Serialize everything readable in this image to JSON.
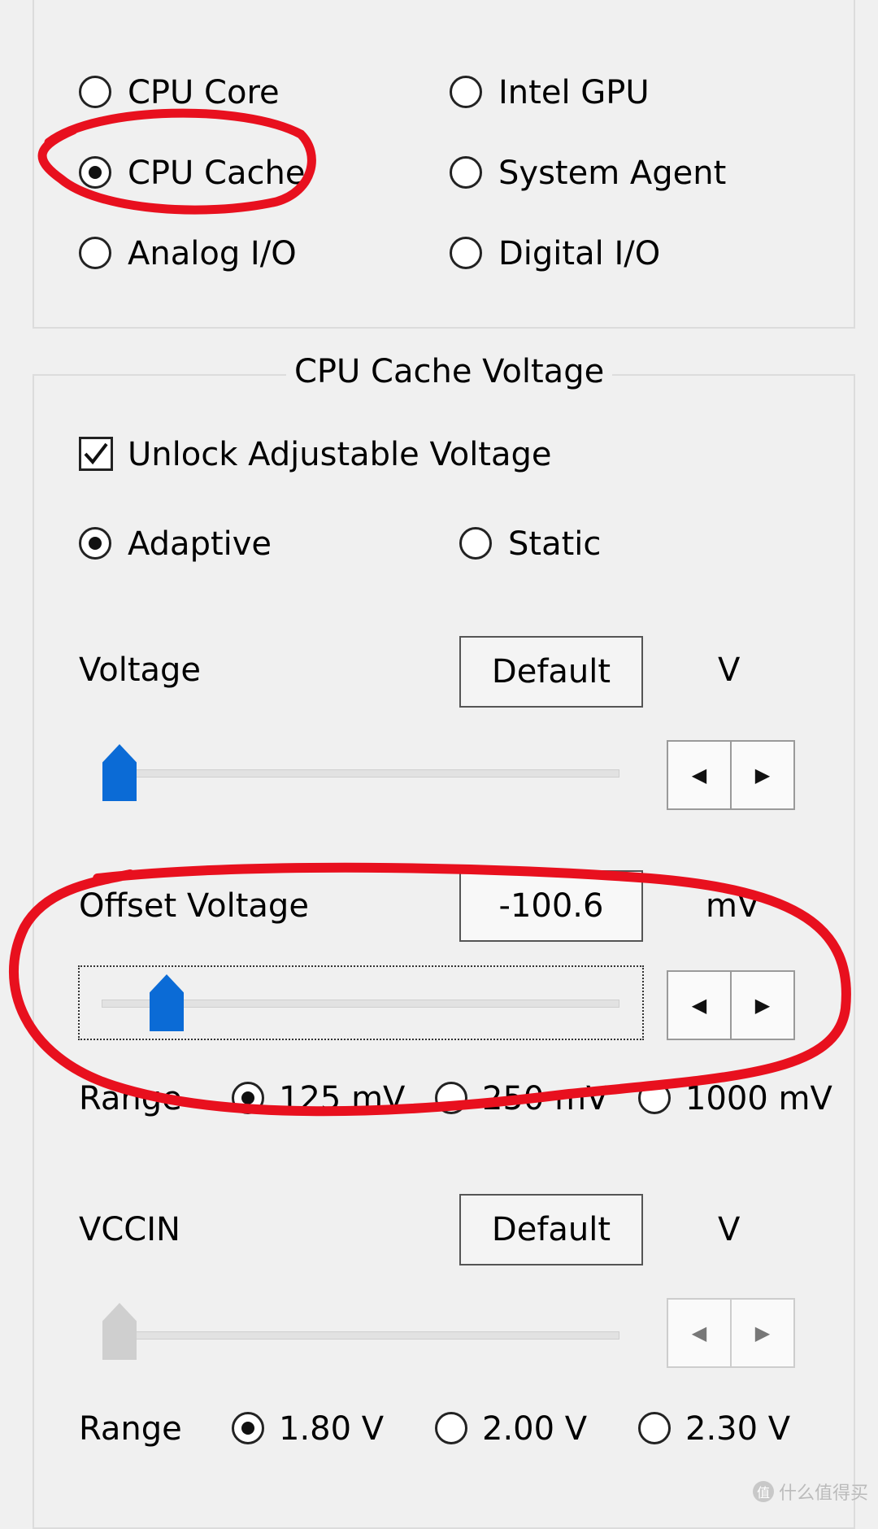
{
  "domain_select": {
    "options": [
      {
        "label": "CPU Core",
        "selected": false
      },
      {
        "label": "Intel GPU",
        "selected": false
      },
      {
        "label": "CPU Cache",
        "selected": true
      },
      {
        "label": "System Agent",
        "selected": false
      },
      {
        "label": "Analog I/O",
        "selected": false
      },
      {
        "label": "Digital I/O",
        "selected": false
      }
    ]
  },
  "group": {
    "title": "CPU Cache Voltage",
    "unlock_label": "Unlock Adjustable Voltage",
    "unlock_checked": true,
    "mode_adaptive": "Adaptive",
    "mode_static": "Static",
    "mode_selected": "Adaptive"
  },
  "voltage": {
    "label": "Voltage",
    "button": "Default",
    "unit": "V",
    "slider_level": 0.0
  },
  "offset": {
    "label": "Offset Voltage",
    "value": "-100.6",
    "unit": "mV",
    "range_label": "Range",
    "ranges": [
      "125 mV",
      "250 mV",
      "1000 mV"
    ],
    "range_selected": "125 mV"
  },
  "vccin": {
    "label": "VCCIN",
    "button": "Default",
    "unit": "V",
    "slider_level": 0.0,
    "range_label": "Range",
    "ranges": [
      "1.80 V",
      "2.00 V",
      "2.30 V"
    ],
    "range_selected": "1.80 V"
  },
  "annotation_color": "#e8101e",
  "accent_color": "#0b6bd6",
  "icons": [
    "radio-icon",
    "checkbox-check-icon",
    "arrow-left-icon",
    "arrow-right-icon",
    "slider-thumb-icon"
  ],
  "watermark": {
    "text": "什么值得买"
  }
}
